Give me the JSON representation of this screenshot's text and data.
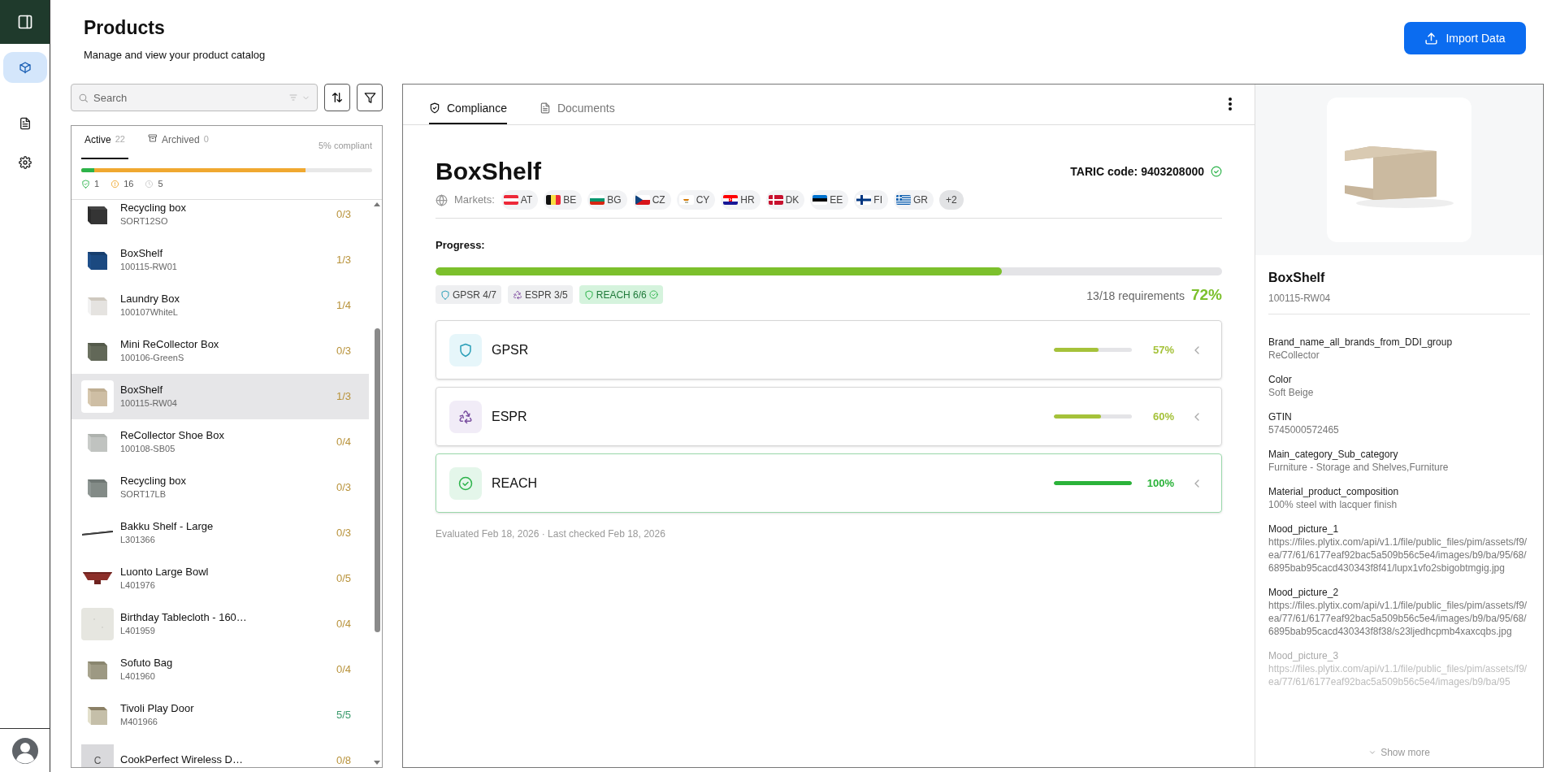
{
  "rail": {
    "nav": [
      {
        "kind": "box",
        "selected": true
      },
      {
        "kind": "document",
        "selected": false
      },
      {
        "kind": "settings",
        "selected": false
      }
    ]
  },
  "header": {
    "title": "Products",
    "subtitle": "Manage and view your product catalog",
    "import_button": "Import Data"
  },
  "search": {
    "placeholder": "Search"
  },
  "list_tabs": [
    {
      "label": "Active",
      "count": "22",
      "selected": true
    },
    {
      "label": "Archived",
      "count": "0",
      "selected": false
    }
  ],
  "compliance_summary": "5% compliant",
  "status_bar": {
    "fills": [
      {
        "kind": "partial",
        "level": 0.772
      },
      {
        "kind": "compliant",
        "level": 0.045
      }
    ]
  },
  "status_summary": [
    {
      "kind": "compliant",
      "count": "1"
    },
    {
      "kind": "partial",
      "count": "16"
    },
    {
      "kind": "pending",
      "count": "5"
    }
  ],
  "products": [
    {
      "name": "Recycling box",
      "sku": "SORT12SO",
      "score": "0/3",
      "complete": false,
      "selected": false
    },
    {
      "name": "BoxShelf",
      "sku": "100115-RW01",
      "score": "1/3",
      "complete": false,
      "selected": false
    },
    {
      "name": "Laundry Box",
      "sku": "100107WhiteL",
      "score": "1/4",
      "complete": false,
      "selected": false
    },
    {
      "name": "Mini ReCollector Box",
      "sku": "100106-GreenS",
      "score": "0/3",
      "complete": false,
      "selected": false
    },
    {
      "name": "BoxShelf",
      "sku": "100115-RW04",
      "score": "1/3",
      "complete": false,
      "selected": true
    },
    {
      "name": "ReCollector Shoe Box",
      "sku": "100108-SB05",
      "score": "0/4",
      "complete": false,
      "selected": false
    },
    {
      "name": "Recycling box",
      "sku": "SORT17LB",
      "score": "0/3",
      "complete": false,
      "selected": false
    },
    {
      "name": "Bakku Shelf - Large",
      "sku": "L301366",
      "score": "0/3",
      "complete": false,
      "selected": false
    },
    {
      "name": "Luonto Large Bowl",
      "sku": "L401976",
      "score": "0/5",
      "complete": false,
      "selected": false
    },
    {
      "name": "Birthday Tablecloth - 160…",
      "sku": "L401959",
      "score": "0/4",
      "complete": false,
      "selected": false
    },
    {
      "name": "Sofuto Bag",
      "sku": "L401960",
      "score": "0/4",
      "complete": false,
      "selected": false
    },
    {
      "name": "Tivoli Play Door",
      "sku": "M401966",
      "score": "5/5",
      "complete": true,
      "selected": false
    },
    {
      "name": "CookPerfect Wireless D…",
      "placeholder_letter": "C",
      "score": "0/8",
      "complete": false,
      "selected": false
    }
  ],
  "detail_tabs": [
    {
      "label": "Compliance",
      "kind": "shield",
      "selected": true
    },
    {
      "label": "Documents",
      "kind": "document",
      "selected": false
    }
  ],
  "product": {
    "name": "BoxShelf",
    "taric": "TARIC code: 9403208000",
    "taric_verified": true
  },
  "markets": {
    "label": "Markets:",
    "items": [
      {
        "code": "AT",
        "kind": "at"
      },
      {
        "code": "BE",
        "kind": "be"
      },
      {
        "code": "BG",
        "kind": "bg"
      },
      {
        "code": "CZ",
        "kind": "cz"
      },
      {
        "code": "CY",
        "kind": "cy"
      },
      {
        "code": "HR",
        "kind": "hr"
      },
      {
        "code": "DK",
        "kind": "dk"
      },
      {
        "code": "EE",
        "kind": "ee"
      },
      {
        "code": "FI",
        "kind": "fi"
      },
      {
        "code": "GR",
        "kind": "gr"
      }
    ],
    "more": "+2"
  },
  "progress": {
    "label": "Progress:",
    "level": 0.72,
    "requirements": "13/18 requirements",
    "percent": "72%",
    "tags": [
      {
        "label": "GPSR 4/7",
        "kind": "shield",
        "complete": false
      },
      {
        "label": "ESPR 3/5",
        "kind": "recycle",
        "complete": false
      },
      {
        "label": "REACH 6/6",
        "kind": "shield",
        "complete": true
      }
    ]
  },
  "regulations": [
    {
      "name": "GPSR",
      "kind": "shield",
      "level": 0.57,
      "percent": "57%",
      "complete": false
    },
    {
      "name": "ESPR",
      "kind": "recycle",
      "level": 0.6,
      "percent": "60%",
      "complete": false
    },
    {
      "name": "REACH",
      "kind": "check",
      "level": 1,
      "percent": "100%",
      "complete": true
    }
  ],
  "evaluated": "Evaluated Feb 18, 2026 · Last checked Feb 18, 2026",
  "details": {
    "name": "BoxShelf",
    "sku": "100115-RW04",
    "fields": [
      {
        "label": "Brand_name_all_brands_from_DDI_group",
        "value": "ReCollector",
        "faded": false
      },
      {
        "label": "Color",
        "value": "Soft Beige",
        "faded": false
      },
      {
        "label": "GTIN",
        "value": "5745000572465",
        "faded": false
      },
      {
        "label": "Main_category_Sub_category",
        "value": "Furniture - Storage and Shelves,Furniture",
        "faded": false
      },
      {
        "label": "Material_product_composition",
        "value": "100% steel with lacquer finish",
        "faded": false
      },
      {
        "label": "Mood_picture_1",
        "value": "https://files.plytix.com/api/v1.1/file/public_files/pim/assets/f9/ea/77/61/6177eaf92bac5a509b56c5e4/images/b9/ba/95/68/6895bab95cacd430343f8f41/lupx1vfo2sbigobtmgig.jpg",
        "faded": false
      },
      {
        "label": "Mood_picture_2",
        "value": "https://files.plytix.com/api/v1.1/file/public_files/pim/assets/f9/ea/77/61/6177eaf92bac5a509b56c5e4/images/b9/ba/95/68/6895bab95cacd430343f8f38/s23ljedhcpmb4xaxcqbs.jpg",
        "faded": false
      },
      {
        "label": "Mood_picture_3",
        "value": "https://files.plytix.com/api/v1.1/file/public_files/pim/assets/f9/ea/77/61/6177eaf92bac5a509b56c5e4/images/b9/ba/95",
        "faded": true
      }
    ],
    "show_more": "Show more"
  }
}
